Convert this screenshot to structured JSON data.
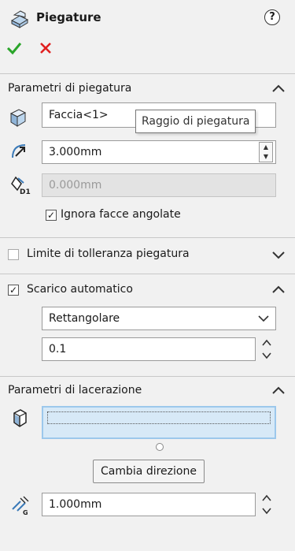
{
  "header": {
    "title": "Piegature",
    "help_icon": "help-icon",
    "confirm_icon": "check-icon",
    "cancel_icon": "close-icon"
  },
  "bend_params": {
    "title": "Parametri di piegatura",
    "face_value": "Faccia<1>",
    "tooltip": "Raggio di piegatura",
    "radius_value": "3.000mm",
    "d1_value": "0.000mm",
    "ignore_label": "Ignora facce angolate",
    "ignore_checked": true
  },
  "tolerance": {
    "title": "Limite di tolleranza piegatura",
    "checked": false
  },
  "relief": {
    "title": "Scarico automatico",
    "checked": true,
    "type_value": "Rettangolare",
    "ratio_value": "0.1"
  },
  "rip_params": {
    "title": "Parametri di lacerazione",
    "change_dir_label": "Cambia direzione",
    "gap_value": "1.000mm"
  },
  "colors": {
    "check": "#2aa52a",
    "cancel": "#e02020",
    "selection_fill": "#d7e9f7",
    "selection_border": "#9cc8ec"
  }
}
